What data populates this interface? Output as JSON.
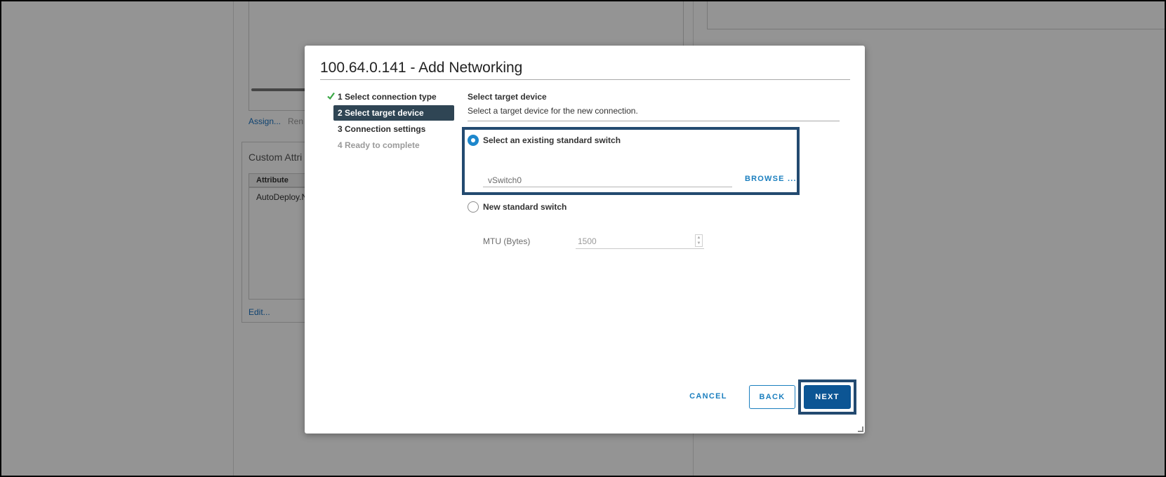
{
  "background": {
    "assign_link": "Assign...",
    "remove_link": "Ren",
    "custom_attributes_title": "Custom Attri",
    "attribute_column": "Attribute",
    "attribute_row": "AutoDeploy.N",
    "edit_link": "Edit..."
  },
  "dialog": {
    "title": "100.64.0.141 - Add Networking",
    "steps": [
      {
        "label": "1 Select connection type",
        "state": "done"
      },
      {
        "label": "2 Select target device",
        "state": "active"
      },
      {
        "label": "3 Connection settings",
        "state": "pending"
      },
      {
        "label": "4 Ready to complete",
        "state": "disabled"
      }
    ],
    "content": {
      "heading": "Select target device",
      "description": "Select a target device for the new connection.",
      "existing_switch_option": "Select an existing standard switch",
      "existing_switch_value": "vSwitch0",
      "browse_label": "BROWSE ...",
      "new_switch_option": "New standard switch",
      "mtu_label": "MTU (Bytes)",
      "mtu_value": "1500"
    },
    "buttons": {
      "cancel": "CANCEL",
      "back": "BACK",
      "next": "NEXT"
    }
  },
  "colors": {
    "accent": "#1b7fbf",
    "primary_button": "#0c5594",
    "active_step": "#2f4554",
    "highlight": "#234a70",
    "check": "#3aa745"
  }
}
